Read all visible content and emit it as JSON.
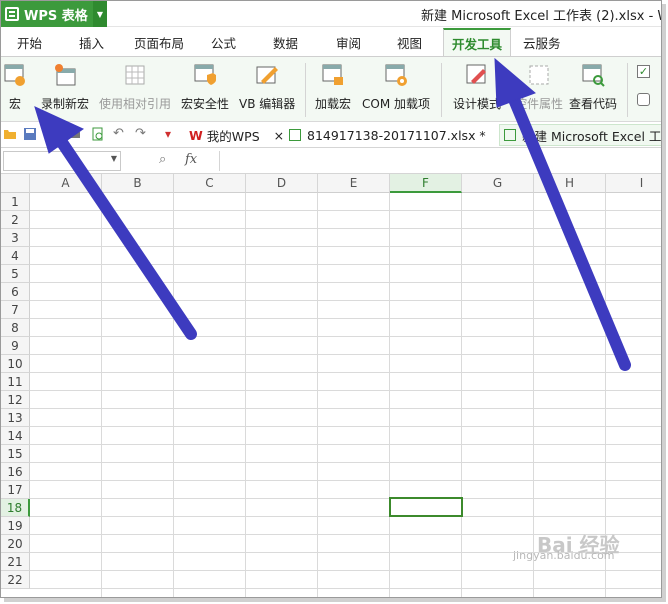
{
  "app": {
    "name": "WPS 表格"
  },
  "window_title": "新建 Microsoft Excel 工作表 (2).xlsx - W",
  "tabs": [
    "开始",
    "插入",
    "页面布局",
    "公式",
    "数据",
    "审阅",
    "视图",
    "开发工具",
    "云服务"
  ],
  "active_tab": "开发工具",
  "toolbar": {
    "items": [
      {
        "label": "宏",
        "icon": "macro-icon",
        "enabled": true
      },
      {
        "label": "录制新宏",
        "icon": "record-macro-icon",
        "enabled": true
      },
      {
        "label": "使用相对引用",
        "icon": "relative-reference-icon",
        "enabled": false
      },
      {
        "label": "宏安全性",
        "icon": "macro-security-icon",
        "enabled": true
      },
      {
        "label": "VB 编辑器",
        "icon": "vb-editor-icon",
        "enabled": true
      },
      {
        "label": "加载宏",
        "icon": "load-macro-icon",
        "enabled": true
      },
      {
        "label": "COM 加载项",
        "icon": "com-addin-icon",
        "enabled": true
      },
      {
        "label": "设计模式",
        "icon": "design-mode-icon",
        "enabled": true
      },
      {
        "label": "控件属性",
        "icon": "control-properties-icon",
        "enabled": false
      },
      {
        "label": "查看代码",
        "icon": "view-code-icon",
        "enabled": true
      }
    ]
  },
  "doc_tabs": [
    {
      "label": "我的WPS",
      "close": "×"
    },
    {
      "label": "814917138-20171107.xlsx *",
      "close": "×"
    },
    {
      "label": "新建 Microsoft Excel 工作"
    }
  ],
  "formula_bar": {
    "name_box": "",
    "fx": "fx"
  },
  "sheet": {
    "columns": [
      "A",
      "B",
      "C",
      "D",
      "E",
      "F",
      "G",
      "H",
      "I"
    ],
    "rows": [
      "1",
      "2",
      "3",
      "4",
      "5",
      "6",
      "7",
      "8",
      "9",
      "10",
      "11",
      "12",
      "13",
      "14",
      "15",
      "16",
      "17",
      "18",
      "19",
      "20",
      "21",
      "22"
    ],
    "selected_column": "F",
    "selected_row": "18"
  },
  "watermark": {
    "brand": "Bai 经验",
    "url": "jingyan.baidu.com"
  },
  "colors": {
    "accent": "#3c9a3c",
    "arrow": "#3d3bbf"
  }
}
